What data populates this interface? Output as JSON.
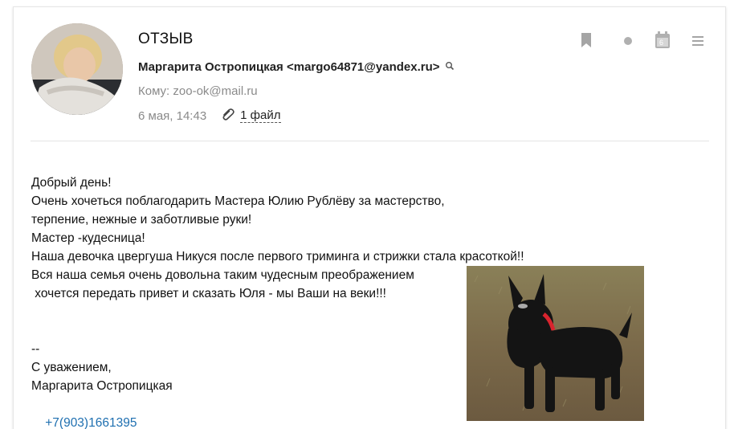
{
  "email": {
    "subject": "ОТЗЫВ",
    "from": "Маргарита Остропицкая <margo64871@yandex.ru>",
    "to": "Кому: zoo-ok@mail.ru",
    "date": "6 мая, 14:43",
    "attachments_label": "1 файл"
  },
  "toolbar": {
    "icons": [
      "bookmark-icon",
      "unread-dot-icon",
      "calendar-icon",
      "more-menu-icon"
    ],
    "calendar_day": "6"
  },
  "body": {
    "lines": [
      "Добрый день!",
      "Очень хочеться поблагодарить Мастера Юлию Рублёву за мастерство,",
      "терпение, нежные и заботливые руки!",
      "Мастер -кудесница!",
      "Наша девочка цвергуша Никуся после первого триминга и стрижки стала красоткой!!",
      "Вся наша семья очень довольна таким чудесным преображением",
      " хочется передать привет и сказать Юля - мы Ваши на веки!!!",
      "",
      "",
      "--",
      "С уважением,",
      "Маргарита Остропицкая"
    ],
    "phone": "+7(903)1661395"
  },
  "colors": {
    "accent_link": "#1e6fb0",
    "muted_text": "#8a8a8a",
    "icon_gray": "#9a9a9a"
  }
}
